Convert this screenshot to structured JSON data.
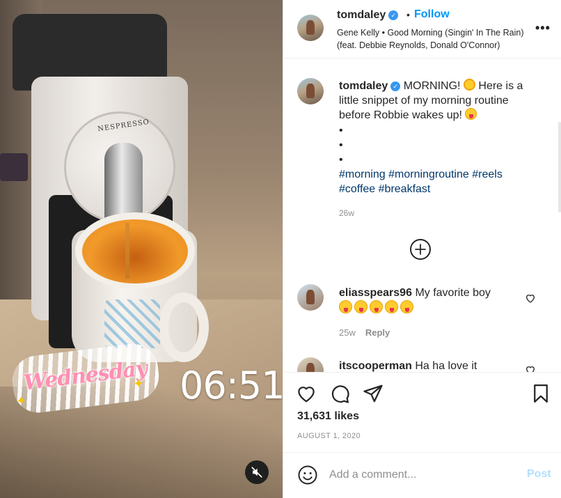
{
  "media": {
    "brand": "NESPRESSO",
    "sticker_text": "Wednesday",
    "time_overlay": "06:51",
    "mute_icon": "speaker-muted-icon"
  },
  "header": {
    "username": "tomdaley",
    "verified_icon": "verified-badge-icon",
    "separator": "•",
    "follow_label": "Follow",
    "song": "Gene Kelly • Good Morning (Singin' In The Rain) (feat. Debbie Reynolds, Donald O'Connor)",
    "more_label": "•••"
  },
  "caption": {
    "username": "tomdaley",
    "text_before": "MORNING!",
    "text_after": "Here is a little snippet of my morning routine before Robbie wakes up!",
    "bullets": [
      "•",
      "•",
      "•"
    ],
    "hashtags": [
      "#morning",
      "#morningroutine",
      "#reels",
      "#coffee",
      "#breakfast"
    ],
    "time": "26w"
  },
  "comments": [
    {
      "username": "eliasspears96",
      "text": "My favorite boy",
      "emoji_count": 5,
      "time": "25w",
      "reply_label": "Reply"
    },
    {
      "username": "itscooperman",
      "text": "Ha ha love it"
    }
  ],
  "actions": {
    "likes": "31,631 likes",
    "date": "AUGUST 1, 2020"
  },
  "add_comment": {
    "placeholder": "Add a comment...",
    "post_label": "Post"
  },
  "colors": {
    "link_blue": "#0095f6",
    "hashtag": "#00376b",
    "muted_text": "#8e8e8e",
    "post_disabled": "#b2dffc"
  }
}
